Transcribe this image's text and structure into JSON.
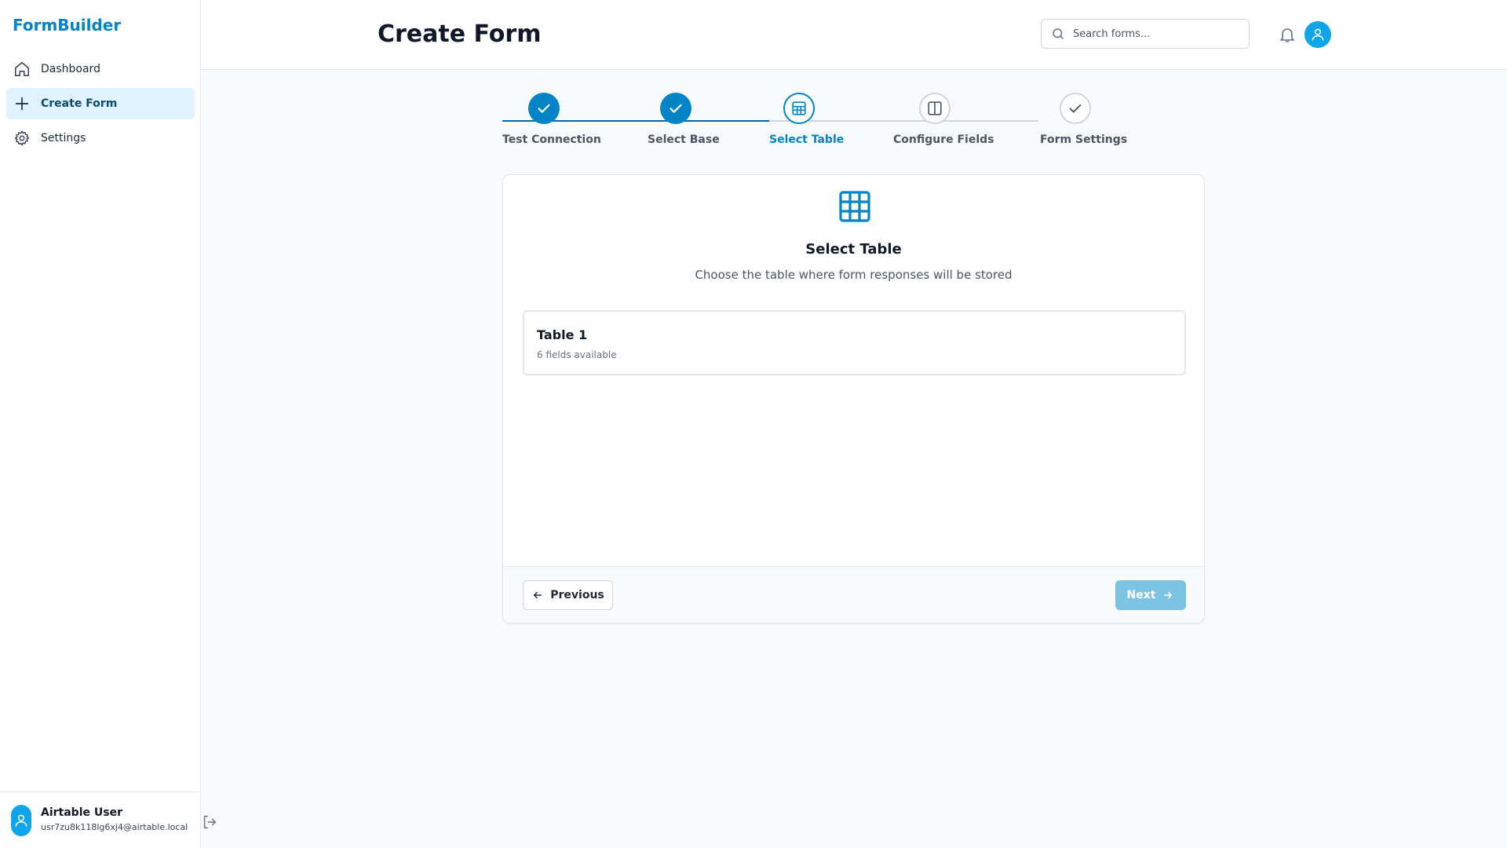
{
  "app": {
    "brand": "FormBuilder"
  },
  "sidebar": {
    "items": [
      {
        "label": "Dashboard",
        "icon": "home-icon"
      },
      {
        "label": "Create Form",
        "icon": "plus-icon",
        "active": true
      },
      {
        "label": "Settings",
        "icon": "gear-icon"
      }
    ],
    "user": {
      "name": "Airtable User",
      "email": "usr7zu8k118lg6xj4@airtable.local"
    }
  },
  "header": {
    "title": "Create Form",
    "search_placeholder": "Search forms..."
  },
  "stepper": {
    "current_index": 2,
    "steps": [
      {
        "label": "Test Connection",
        "status": "done"
      },
      {
        "label": "Select Base",
        "status": "done"
      },
      {
        "label": "Select Table",
        "status": "current"
      },
      {
        "label": "Configure Fields",
        "status": "upcoming"
      },
      {
        "label": "Form Settings",
        "status": "upcoming"
      }
    ]
  },
  "card": {
    "title": "Select Table",
    "subtitle": "Choose the table where form responses will be stored",
    "tables": [
      {
        "name": "Table 1",
        "fields": "6 fields available"
      }
    ],
    "prev_label": "Previous",
    "next_label": "Next"
  },
  "colors": {
    "accent": "#0284c7",
    "accent_light": "#e0f2fe",
    "next_disabled": "#7dc4e4",
    "avatar": "#0ea5e9"
  }
}
